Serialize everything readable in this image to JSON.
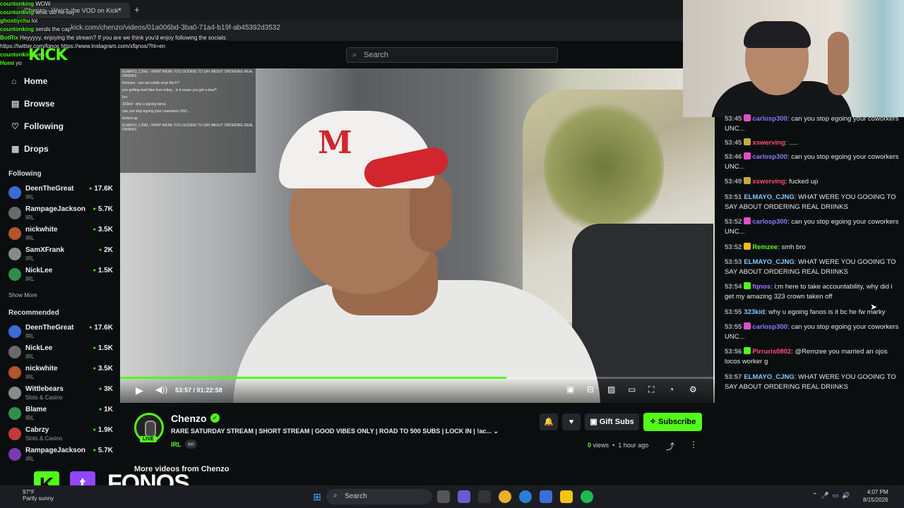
{
  "browser": {
    "tab_title": "Chenzo - Watch the VOD on Kick",
    "url": "kick.com/chenzo/videos/01a006bd-3ba0-71a4-b19f-ab45392d3532",
    "new_tab": "+",
    "close_tab": "×"
  },
  "top_overlay_chat": [
    {
      "user": "countonking",
      "text": "WOW"
    },
    {
      "user": "countonking",
      "text": "what did he say"
    },
    {
      "user": "ghostiychu",
      "text": "lol"
    },
    {
      "user": "countonking",
      "text": "sends the cap"
    },
    {
      "user": "BotRix",
      "text": "Heyyyyy, enjoying the stream? If you are we think you'd enjoy following the socials: https://twitter.com/fqnos https://www.instagram.com/xfqnos/?hl=en"
    },
    {
      "user": "countonking",
      "text": "yea"
    },
    {
      "user": "Homi",
      "text": "yo"
    }
  ],
  "kick_logo": "KICK",
  "search": {
    "placeholder": "Search"
  },
  "sidebar": {
    "nav": [
      {
        "label": "Home",
        "icon": "home-icon",
        "glyph": "⌂"
      },
      {
        "label": "Browse",
        "icon": "browse-icon",
        "glyph": "▤"
      },
      {
        "label": "Following",
        "icon": "heart-icon",
        "glyph": "♡"
      },
      {
        "label": "Drops",
        "icon": "drops-icon",
        "glyph": "▦"
      }
    ],
    "following_label": "Following",
    "following": [
      {
        "name": "DeenTheGreat",
        "category": "IRL",
        "viewers": "17.6K"
      },
      {
        "name": "RampageJackson",
        "category": "IRL",
        "viewers": "5.7K"
      },
      {
        "name": "nickwhite",
        "category": "IRL",
        "viewers": "3.5K"
      },
      {
        "name": "SamXFrank",
        "category": "IRL",
        "viewers": "2K"
      },
      {
        "name": "NickLee",
        "category": "IRL",
        "viewers": "1.5K"
      }
    ],
    "show_more": "Show More",
    "recommended_label": "Recommended",
    "recommended": [
      {
        "name": "DeenTheGreat",
        "category": "IRL",
        "viewers": "17.6K"
      },
      {
        "name": "NickLee",
        "category": "IRL",
        "viewers": "1.5K"
      },
      {
        "name": "nickwhite",
        "category": "IRL",
        "viewers": "3.5K"
      },
      {
        "name": "Wittlebears",
        "category": "Slots & Casino",
        "viewers": "3K"
      },
      {
        "name": "Blame",
        "category": "IRL",
        "viewers": "1K"
      },
      {
        "name": "Cabrzy",
        "category": "Slots & Casino",
        "viewers": "1.9K"
      },
      {
        "name": "RampageJackson",
        "category": "IRL",
        "viewers": "5.7K"
      }
    ]
  },
  "video": {
    "overlay_chat": [
      "ELMAYO_CJNG : WHAT WERE YOU GOOING TO SAY ABOUT ORDERING REAL DRIINKS",
      "Remzee : can we collab soon the fr?",
      "you getting mad fake love today... is it cause you got a deal?",
      "bro",
      "323kid : why u egoing fanos",
      "can you stop egoing your coworkers UNC...",
      "fucked up",
      "ELMAYO_CJNG : WHAT WERE YOU GOOING TO SAY ABOUT ORDERING REAL DRIINKS"
    ],
    "cap_logo": "M",
    "current_time": "53:57",
    "duration": "01:22:58",
    "progress_fraction": 0.65,
    "play_glyph": "▶",
    "volume_glyph": "🔊"
  },
  "channel": {
    "name": "Chenzo",
    "verified_glyph": "✓",
    "live": "LIVE",
    "title": "RARE SATURDAY STREAM | SHORT STREAM | GOOD VIBES ONLY | ROAD TO 500 SUBS | LOCK IN | !ac...",
    "category": "IRL",
    "language": "en",
    "gift_subs": "Gift Subs",
    "subscribe": "Subscribe",
    "views_count": "0",
    "views_label": "views",
    "age": "1 hour ago",
    "more_videos": "More videos from Chenzo"
  },
  "chat": [
    {
      "time": "53:45",
      "user": "carlosp300",
      "color": "#8b7bff",
      "text": "can you stop egoing your coworkers UNC...",
      "badge_color": "#e04fc8"
    },
    {
      "time": "53:45",
      "user": "xswerving",
      "color": "#ff4d6d",
      "text": ".....",
      "badge_color": "#c9a93b"
    },
    {
      "time": "53:46",
      "user": "carlosp300",
      "color": "#8b7bff",
      "text": "can you stop egoing your coworkers UNC...",
      "badge_color": "#e04fc8"
    },
    {
      "time": "53:49",
      "user": "xswerving",
      "color": "#ff4d6d",
      "text": "fucked up",
      "badge_color": "#c9a93b"
    },
    {
      "time": "53:51",
      "user": "ELMAYO_CJNG",
      "color": "#7ec8ff",
      "text": "WHAT WERE YOU GOOING TO SAY ABOUT ORDERING REAL DRIINKS",
      "badge_color": ""
    },
    {
      "time": "53:52",
      "user": "carlosp300",
      "color": "#8b7bff",
      "text": "can you stop egoing your coworkers UNC...",
      "badge_color": "#e04fc8"
    },
    {
      "time": "53:52",
      "user": "Remzee",
      "color": "#53fc18",
      "text": "smh bro",
      "badge_color": "#f2b71c"
    },
    {
      "time": "53:53",
      "user": "ELMAYO_CJNG",
      "color": "#7ec8ff",
      "text": "WHAT WERE YOU GOOING TO SAY ABOUT ORDERING REAL DRIINKS",
      "badge_color": ""
    },
    {
      "time": "53:54",
      "user": "fqnos",
      "color": "#b06cff",
      "text": "i;m here to take accountability, why did i get my amazing 323 crown taken off",
      "badge_color": "#53fc18"
    },
    {
      "time": "53:55",
      "user": "323kid",
      "color": "#7ec8ff",
      "text": "why u egoing fanos is it bc he fw marky",
      "badge_color": ""
    },
    {
      "time": "53:55",
      "user": "carlosp300",
      "color": "#8b7bff",
      "text": "can you stop egoing your coworkers UNC...",
      "badge_color": "#e04fc8"
    },
    {
      "time": "53:56",
      "user": "Pirruris0802",
      "color": "#ff4d8d",
      "text": "@Remzee you married an ojos locos worker g",
      "badge_color": "#53fc18"
    },
    {
      "time": "53:57",
      "user": "ELMAYO_CJNG",
      "color": "#7ec8ff",
      "text": "WHAT WERE YOU GOOING TO SAY ABOUT ORDERING REAL DRIINKS",
      "badge_color": ""
    }
  ],
  "branding": {
    "k": "K",
    "t": "t",
    "name": "FQNOS"
  },
  "taskbar": {
    "search": "Search",
    "weather_temp": "97°F",
    "weather_desc": "Partly sunny",
    "time": "4:07 PM",
    "date": "8/15/2026"
  }
}
